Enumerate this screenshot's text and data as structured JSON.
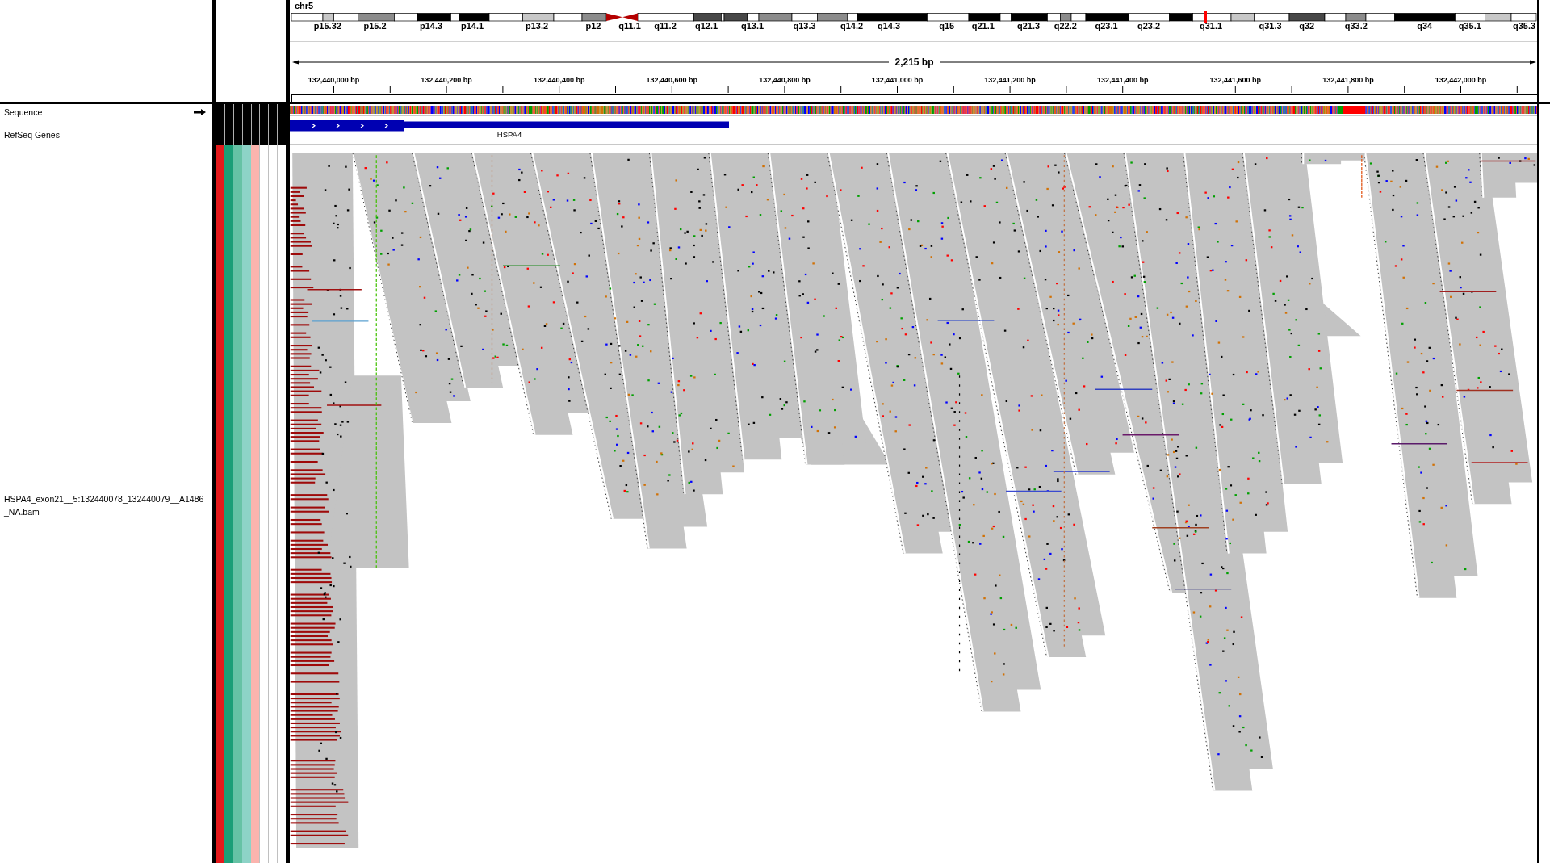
{
  "ideogram": {
    "chromosome": "chr5",
    "band_labels": [
      "p15.32",
      "p15.2",
      "p14.3",
      "p14.1",
      "p13.2",
      "p12",
      "q11.1",
      "q11.2",
      "q12.1",
      "q13.1",
      "q13.3",
      "q14.2",
      "q14.3",
      "q15",
      "q21.1",
      "q21.3",
      "q22.2",
      "q23.1",
      "q23.2",
      "q31.1",
      "q31.3",
      "q32",
      "q33.2",
      "q34",
      "q35.1",
      "q35.3"
    ]
  },
  "ruler": {
    "span": "2,215 bp",
    "ticks": [
      "132,440,000 bp",
      "132,440,200 bp",
      "132,440,400 bp",
      "132,440,600 bp",
      "132,440,800 bp",
      "132,441,000 bp",
      "132,441,200 bp",
      "132,441,400 bp",
      "132,441,600 bp",
      "132,441,800 bp",
      "132,442,000 bp"
    ]
  },
  "tracks": [
    {
      "kind": "sequence",
      "name": "Sequence",
      "forward_strand": true
    },
    {
      "kind": "gene",
      "name": "RefSeq Genes",
      "feature_label": "HSPA4"
    },
    {
      "kind": "alignment",
      "name_lines": [
        "HSPA4_exon21__5:132440078_132440079__A1486",
        "_NA.bam"
      ],
      "attributes": [
        {
          "color": "#e41a1c"
        },
        {
          "color": "#1b9e77"
        },
        {
          "color": "#66c2a5"
        },
        {
          "color": "#8dd3c7"
        },
        {
          "color": "#fbb4ae"
        }
      ]
    }
  ]
}
